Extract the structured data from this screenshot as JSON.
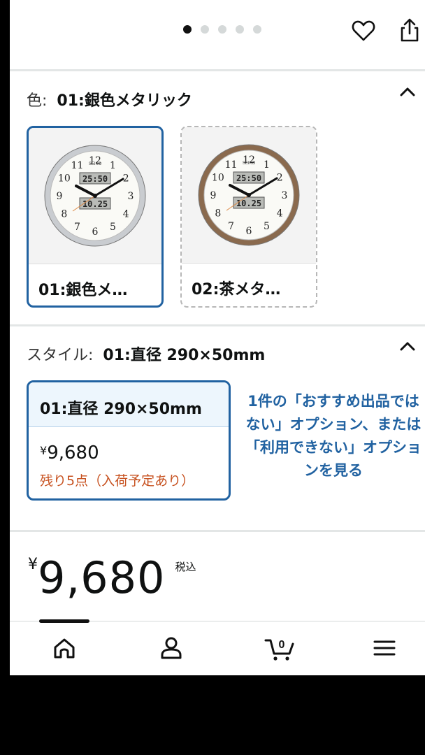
{
  "carousel": {
    "count": 5,
    "active": 0
  },
  "header": {
    "wishlist_icon": "heart-icon",
    "share_icon": "share-icon"
  },
  "color_section": {
    "label": "色:",
    "selected": "01:銀色メタリック",
    "options": [
      {
        "name": "01:銀色メ…",
        "frame_color": "#c9ccd0",
        "selected": true
      },
      {
        "name": "02:茶メタ…",
        "frame_color": "#8a6a4e",
        "selected": false
      }
    ]
  },
  "clock_face": {
    "brand": "SEIKO",
    "top_display": "25:50",
    "bottom_display": "10.25",
    "numbers": [
      "12",
      "1",
      "2",
      "3",
      "4",
      "5",
      "6",
      "7",
      "8",
      "9",
      "10",
      "11"
    ]
  },
  "style_section": {
    "label": "スタイル:",
    "selected": "01:直径 290×50mm",
    "option": {
      "name": "01:直径 290×50mm",
      "currency": "¥",
      "price": "9,680",
      "stock": "残り5点（入荷予定あり）"
    },
    "more_link": "1件の「おすすめ出品ではない」オプション、または「利用できない」オプションを見る"
  },
  "price": {
    "currency": "¥",
    "value": "9,680",
    "tax_note": "税込"
  },
  "bottom_nav": {
    "items": [
      "home-icon",
      "account-icon",
      "cart-icon",
      "menu-icon"
    ],
    "cart_count": "0"
  },
  "colors": {
    "accent": "#2162a1",
    "stock": "#c7511f"
  }
}
